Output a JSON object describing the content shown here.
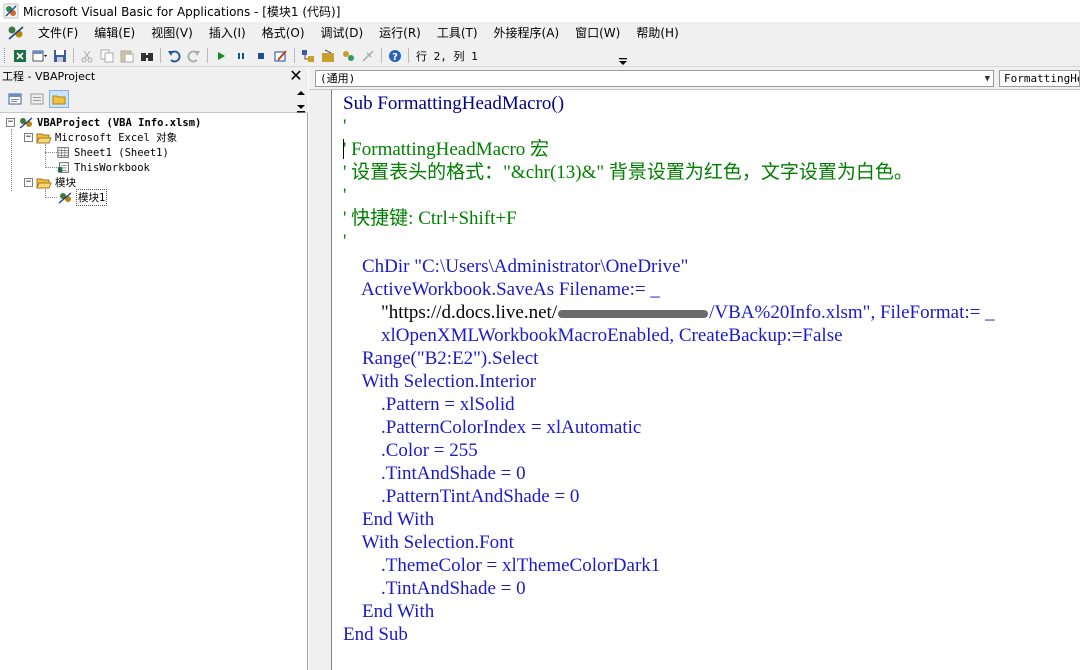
{
  "window": {
    "title": "Microsoft Visual Basic for Applications - [模块1 (代码)]"
  },
  "menu": {
    "items": [
      {
        "label": "文件(F)"
      },
      {
        "label": "编辑(E)"
      },
      {
        "label": "视图(V)"
      },
      {
        "label": "插入(I)"
      },
      {
        "label": "格式(O)"
      },
      {
        "label": "调试(D)"
      },
      {
        "label": "运行(R)"
      },
      {
        "label": "工具(T)"
      },
      {
        "label": "外接程序(A)"
      },
      {
        "label": "窗口(W)"
      },
      {
        "label": "帮助(H)"
      }
    ]
  },
  "toolbar": {
    "cursor_position": "行 2, 列 1",
    "icons": [
      "excel-icon",
      "insert-module-icon",
      "save-icon",
      "cut-icon",
      "copy-icon",
      "paste-icon",
      "find-icon",
      "undo-icon",
      "redo-icon",
      "run-icon",
      "break-icon",
      "reset-icon",
      "design-mode-icon",
      "project-explorer-icon",
      "properties-icon",
      "object-browser-icon",
      "toolbox-icon",
      "help-icon"
    ]
  },
  "project_explorer": {
    "title": "工程 - VBAProject",
    "close_label": "✕",
    "tree": {
      "project_label": "VBAProject (VBA Info.xlsm)",
      "excel_objects_label": "Microsoft Excel 对象",
      "sheet1_label": "Sheet1 (Sheet1)",
      "thisworkbook_label": "ThisWorkbook",
      "modules_label": "模块",
      "module1_label": "模块1"
    }
  },
  "code_window": {
    "object_combo": "(通用)",
    "procedure_combo": "FormattingHeadMacro",
    "lines": [
      [
        "Sub FormattingHeadMacro()"
      ],
      [
        "'"
      ],
      [
        "' FormattingHeadMacro 宏"
      ],
      [
        "' 设置表头的格式：\"&chr(13)&\" 背景设置为红色，文字设置为白色。"
      ],
      [
        "'"
      ],
      [
        "' 快捷键: Ctrl+Shift+F"
      ],
      [
        "'"
      ],
      [
        "    ChDir \"C:\\Users\\Administrator\\OneDrive\""
      ],
      [
        "    ActiveWorkbook.SaveAs Filename:= _"
      ],
      [
        "        \"https://d.docs.live.net/",
        "/VBA%20Info.xlsm\", FileFormat:= _"
      ],
      [
        "        xlOpenXMLWorkbookMacroEnabled, CreateBackup:=False"
      ],
      [
        "    Range(\"B2:E2\").Select"
      ],
      [
        "    With Selection.Interior"
      ],
      [
        "        .Pattern = xlSolid"
      ],
      [
        "        .PatternColorIndex = xlAutomatic"
      ],
      [
        "        .Color = 255"
      ],
      [
        "        .TintAndShade = 0"
      ],
      [
        "        .PatternTintAndShade = 0"
      ],
      [
        "    End With"
      ],
      [
        "    With Selection.Font"
      ],
      [
        "        .ThemeColor = xlThemeColorDark1"
      ],
      [
        "        .TintAndShade = 0"
      ],
      [
        "    End With"
      ],
      [
        "End Sub"
      ]
    ]
  },
  "colors": {
    "keyword": "#00008b",
    "comment": "#008000",
    "text": "#000000"
  }
}
